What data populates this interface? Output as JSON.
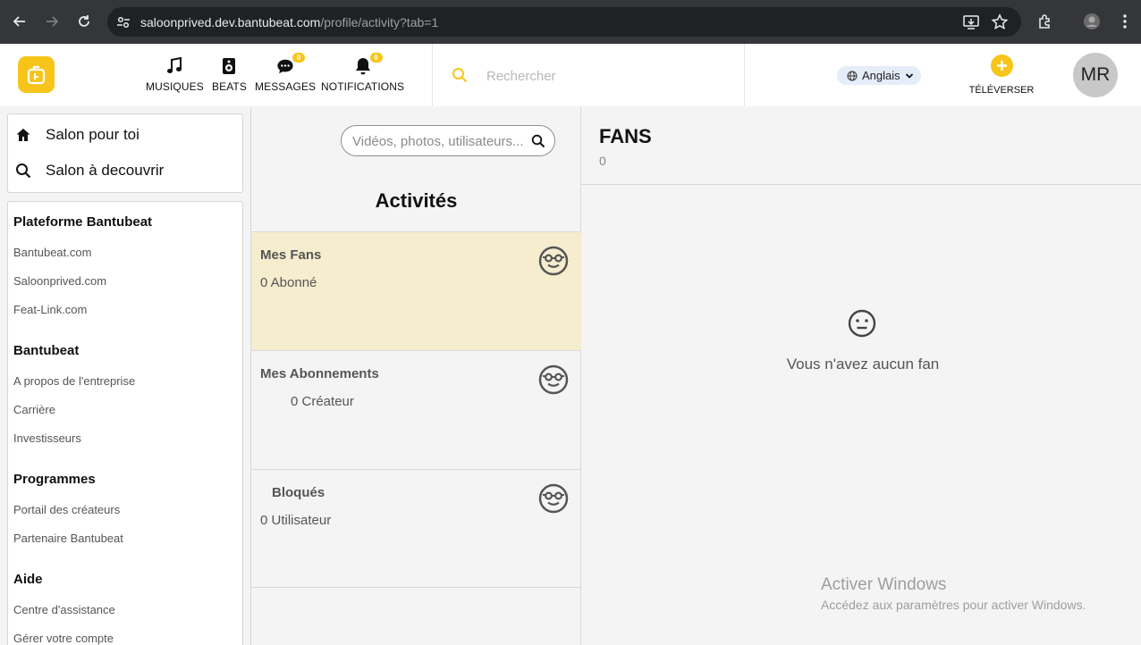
{
  "browser": {
    "url_host": "saloonprived.dev.bantubeat.com",
    "url_path": "/profile/activity?tab=1"
  },
  "header": {
    "nav": [
      {
        "label": "MUSIQUES",
        "icon": "music-note-icon"
      },
      {
        "label": "BEATS",
        "icon": "speaker-icon"
      },
      {
        "label": "MESSAGES",
        "icon": "chat-bubble-icon",
        "badge": "0"
      },
      {
        "label": "NOTIFICATIONS",
        "icon": "bell-icon",
        "badge": "0"
      }
    ],
    "search_placeholder": "Rechercher",
    "language": "Anglais",
    "upload_label": "TÉLÉVERSER",
    "avatar_initials": "MR",
    "accent_color": "#f7c51a"
  },
  "sidebar": {
    "salon_items": [
      {
        "label": "Salon pour toi",
        "icon": "home-icon"
      },
      {
        "label": "Salon à decouvrir",
        "icon": "search-icon"
      }
    ],
    "sections": [
      {
        "title": "Plateforme Bantubeat",
        "links": [
          "Bantubeat.com",
          "Saloonprived.com",
          "Feat-Link.com"
        ]
      },
      {
        "title": "Bantubeat",
        "links": [
          "A propos de l'entreprise",
          "Carrière",
          "Investisseurs"
        ]
      },
      {
        "title": "Programmes",
        "links": [
          "Portail des créateurs",
          "Partenaire Bantubeat"
        ]
      },
      {
        "title": "Aide",
        "links": [
          "Centre d'assistance",
          "Gérer votre compte"
        ]
      }
    ]
  },
  "activities": {
    "search_placeholder": "Vidéos, photos, utilisateurs...",
    "title": "Activités",
    "items": [
      {
        "title": "Mes Fans",
        "sub": "0 Abonné",
        "icon": "smiley-glasses-icon"
      },
      {
        "title": "Mes Abonnements",
        "sub": "0 Créateur",
        "icon": "smiley-glasses-icon"
      },
      {
        "title": "Bloqués",
        "sub": "0 Utilisateur",
        "icon": "smiley-glasses-icon"
      }
    ]
  },
  "fans_panel": {
    "title": "FANS",
    "count": "0",
    "empty_text": "Vous n'avez aucun fan",
    "empty_icon": "neutral-face-icon"
  },
  "watermark": {
    "line1": "Activer Windows",
    "line2": "Accédez aux paramètres pour activer Windows."
  }
}
